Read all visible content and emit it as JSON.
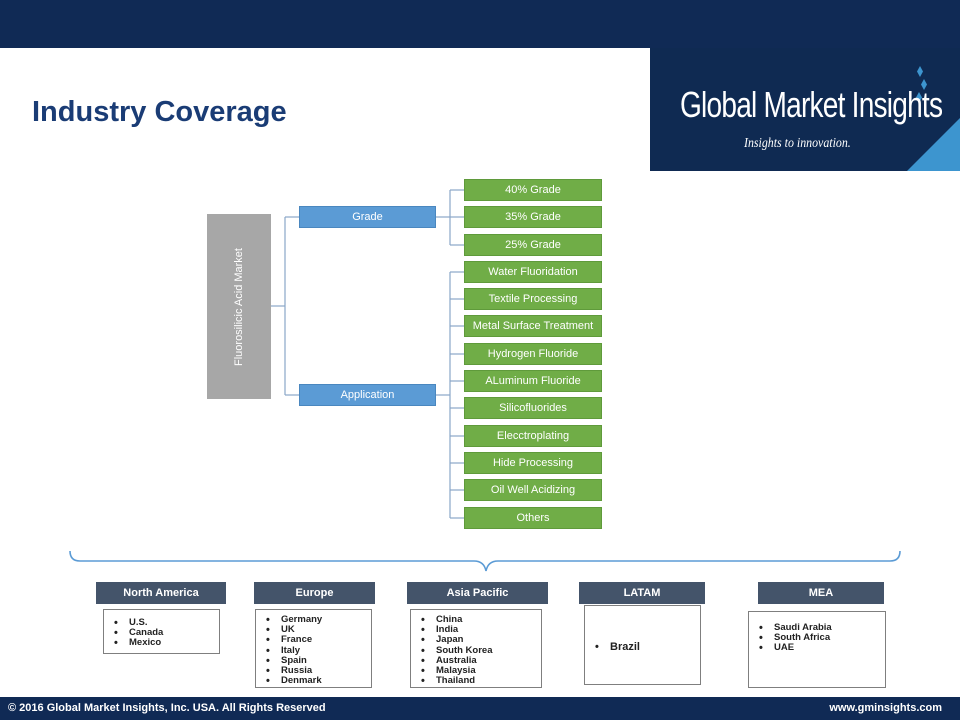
{
  "title": "Industry Coverage",
  "logo": {
    "name": "Global Market Insights",
    "tagline": "Insights to innovation."
  },
  "tree": {
    "root": "Fluorosilicic Acid Market",
    "grade": {
      "label": "Grade",
      "items": [
        "40% Grade",
        "35% Grade",
        "25% Grade"
      ]
    },
    "application": {
      "label": "Application",
      "items": [
        "Water Fluoridation",
        "Textile Processing",
        "Metal Surface Treatment",
        "Hydrogen  Fluoride",
        "ALuminum Fluoride",
        "Silicofluorides",
        "Elecctroplating",
        "Hide Processing",
        "Oil Well Acidizing",
        "Others"
      ]
    }
  },
  "regions": [
    {
      "name": "North America",
      "countries": [
        "U.S.",
        "Canada",
        "Mexico"
      ]
    },
    {
      "name": "Europe",
      "countries": [
        "Germany",
        "UK",
        "France",
        "Italy",
        "Spain",
        "Russia",
        "Denmark"
      ]
    },
    {
      "name": "Asia Pacific",
      "countries": [
        "China",
        "India",
        "Japan",
        "South Korea",
        "Australia",
        "Malaysia",
        "Thailand"
      ]
    },
    {
      "name": "LATAM",
      "countries": [
        "Brazil"
      ]
    },
    {
      "name": "MEA",
      "countries": [
        "Saudi Arabia",
        "South Africa",
        "UAE"
      ]
    }
  ],
  "footer": {
    "copyright": "© 2016 Global Market Insights, Inc. USA.  All Rights Reserved",
    "website": "www.gminsights.com"
  },
  "colors": {
    "navy": "#102a55",
    "title": "#1a3c75",
    "blue_node": "#5b9bd5",
    "green_leaf": "#70ad47",
    "grey_root": "#a7a7a7",
    "region_header": "#44546a"
  }
}
